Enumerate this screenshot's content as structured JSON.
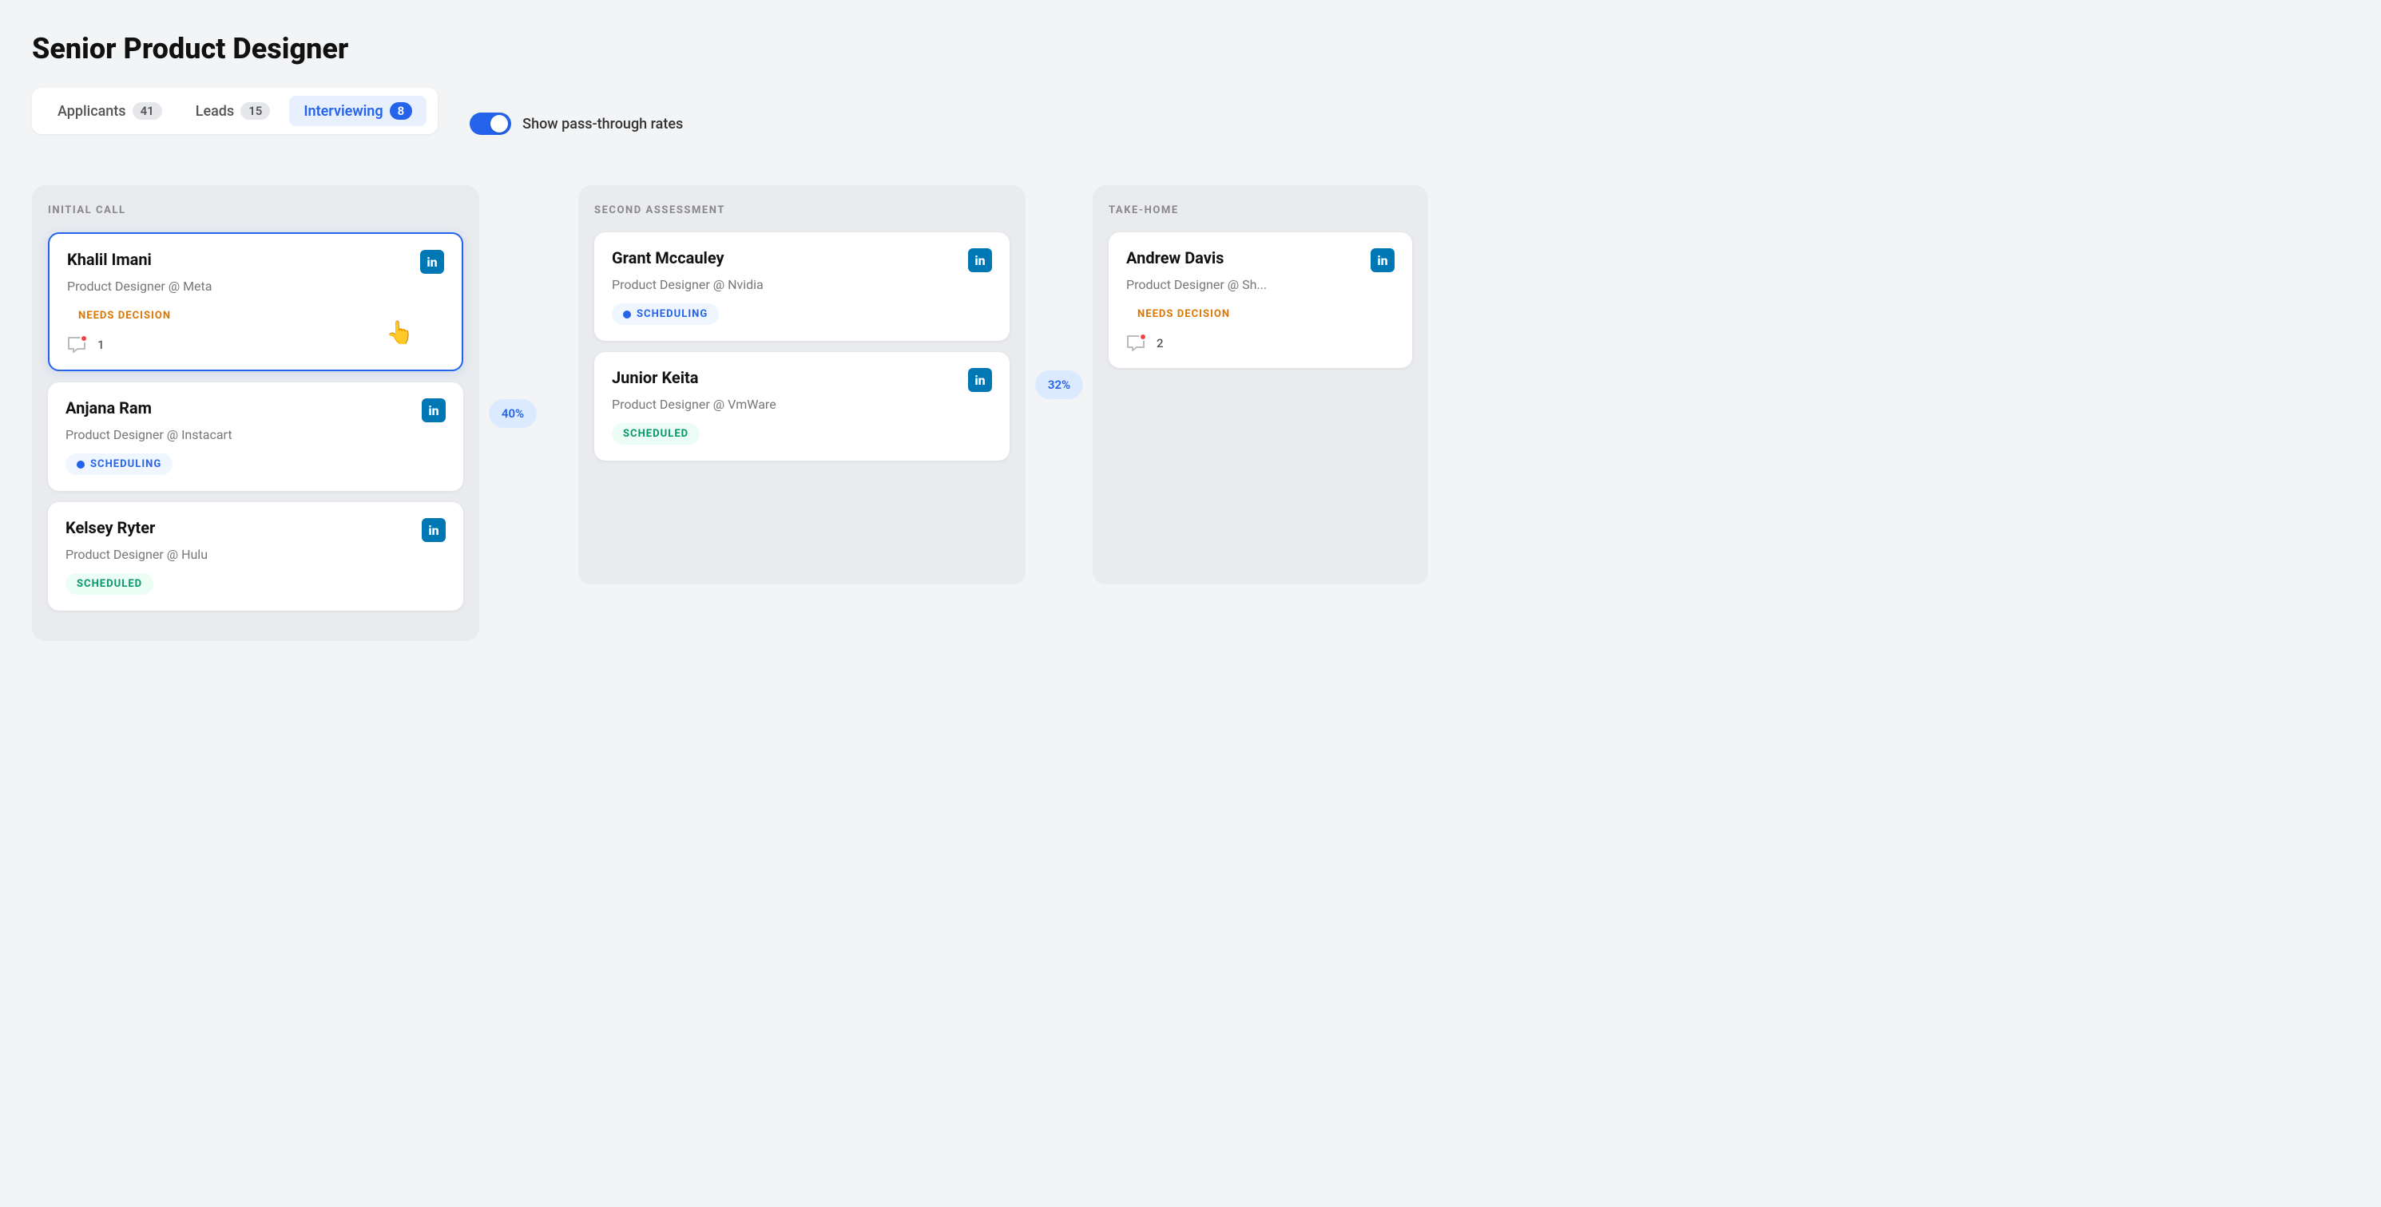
{
  "page": {
    "title": "Senior Product Designer"
  },
  "tabs": [
    {
      "id": "applicants",
      "label": "Applicants",
      "badge": "41",
      "active": false
    },
    {
      "id": "leads",
      "label": "Leads",
      "badge": "15",
      "active": false
    },
    {
      "id": "interviewing",
      "label": "Interviewing",
      "badge": "8",
      "active": true
    }
  ],
  "toggle": {
    "label": "Show pass-through rates",
    "enabled": true
  },
  "columns": [
    {
      "id": "initial-call",
      "title": "INITIAL CALL",
      "passRate": "40%",
      "candidates": [
        {
          "id": "khalil-imani",
          "name": "Khalil Imani",
          "role": "Product Designer @ Meta",
          "status": "needs-decision",
          "statusLabel": "NEEDS DECISION",
          "comments": 1,
          "hasCommentAlert": true,
          "selected": true
        },
        {
          "id": "anjana-ram",
          "name": "Anjana Ram",
          "role": "Product Designer @ Instacart",
          "status": "scheduling",
          "statusLabel": "SCHEDULING",
          "comments": 0,
          "hasCommentAlert": false,
          "selected": false
        },
        {
          "id": "kelsey-ryter",
          "name": "Kelsey Ryter",
          "role": "Product Designer @ Hulu",
          "status": "scheduled",
          "statusLabel": "SCHEDULED",
          "comments": 0,
          "hasCommentAlert": false,
          "selected": false
        }
      ]
    },
    {
      "id": "second-assessment",
      "title": "SECOND ASSESSMENT",
      "passRate": "32%",
      "candidates": [
        {
          "id": "grant-mccauley",
          "name": "Grant Mccauley",
          "role": "Product Designer @ Nvidia",
          "status": "scheduling",
          "statusLabel": "SCHEDULING",
          "comments": 0,
          "hasCommentAlert": false,
          "selected": false
        },
        {
          "id": "junior-keita",
          "name": "Junior Keita",
          "role": "Product Designer @ VmWare",
          "status": "scheduled",
          "statusLabel": "SCHEDULED",
          "comments": 0,
          "hasCommentAlert": false,
          "selected": false
        }
      ]
    },
    {
      "id": "take-home",
      "title": "TAKE-HOME",
      "passRate": null,
      "candidates": [
        {
          "id": "andrew-davis",
          "name": "Andrew Davis",
          "role": "Product Designer @ Sh...",
          "status": "needs-decision",
          "statusLabel": "NEEDS DECISION",
          "comments": 2,
          "hasCommentAlert": true,
          "selected": false
        }
      ]
    }
  ]
}
